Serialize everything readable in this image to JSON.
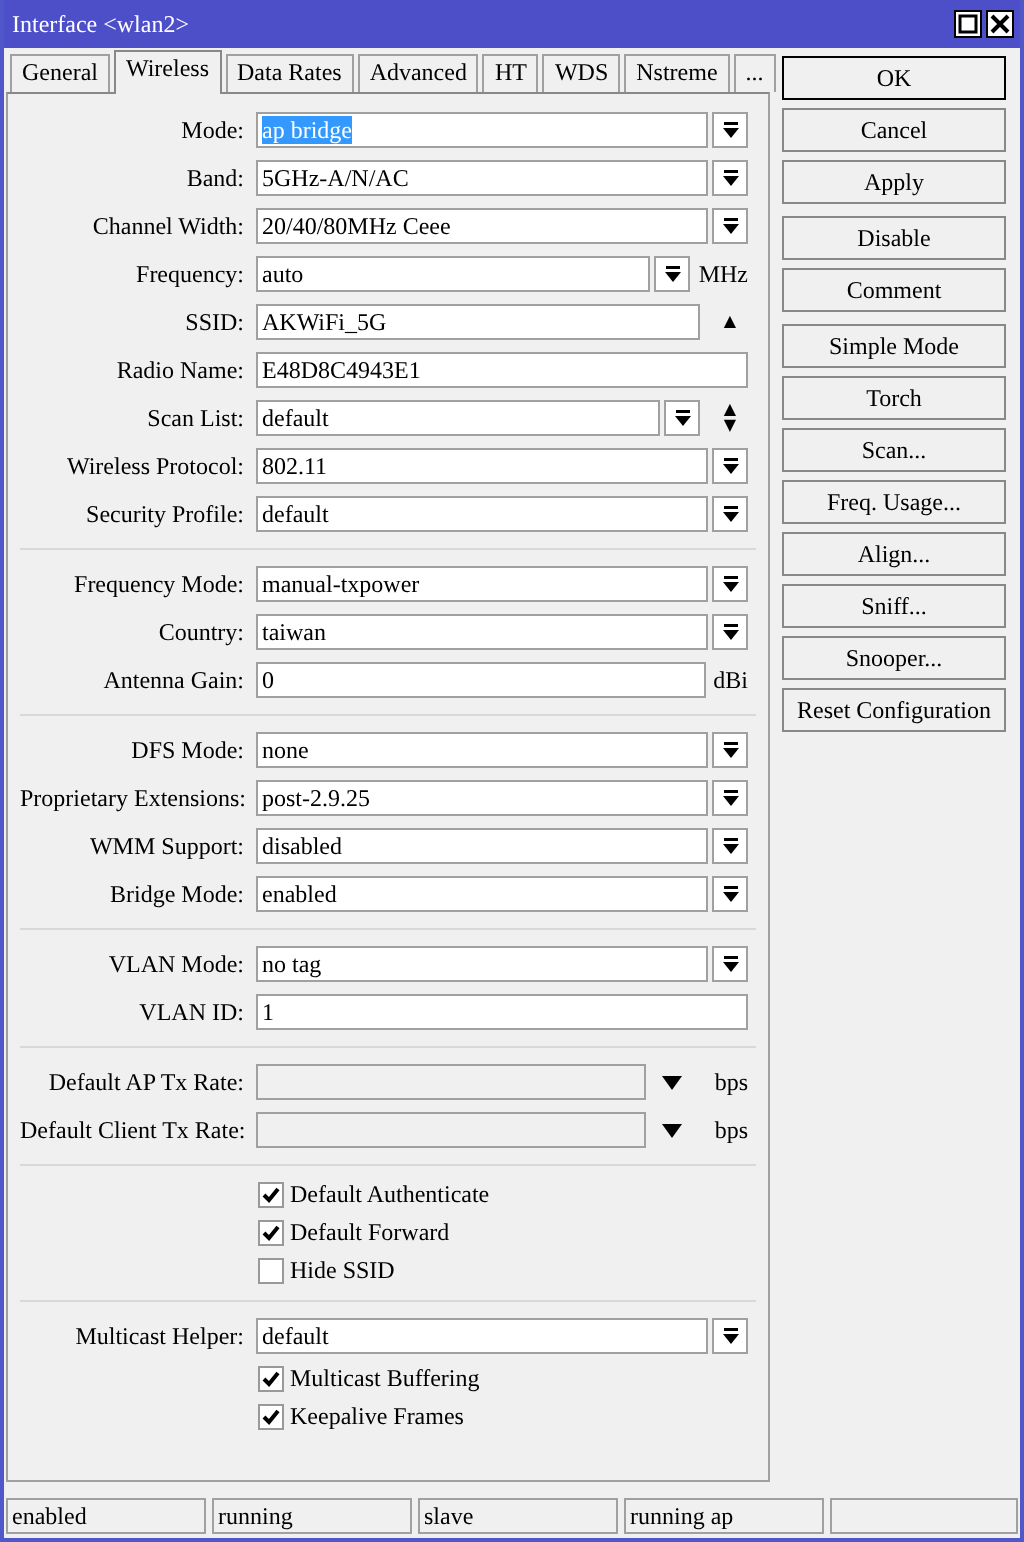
{
  "window": {
    "title": "Interface <wlan2>"
  },
  "tabs": [
    {
      "label": "General",
      "selected": false
    },
    {
      "label": "Wireless",
      "selected": true
    },
    {
      "label": "Data Rates",
      "selected": false
    },
    {
      "label": "Advanced",
      "selected": false
    },
    {
      "label": "HT",
      "selected": false
    },
    {
      "label": "WDS",
      "selected": false
    },
    {
      "label": "Nstreme",
      "selected": false
    },
    {
      "label": "...",
      "selected": false
    }
  ],
  "sections": [
    {
      "rows": [
        {
          "kind": "select",
          "label": "Mode:",
          "value": "ap bridge",
          "highlighted": true
        },
        {
          "kind": "select",
          "label": "Band:",
          "value": "5GHz-A/N/AC",
          "highlighted": false
        },
        {
          "kind": "select",
          "label": "Channel Width:",
          "value": "20/40/80MHz Ceee",
          "highlighted": false
        },
        {
          "kind": "select",
          "label": "Frequency:",
          "value": "auto",
          "unit": "MHz",
          "highlighted": false
        },
        {
          "kind": "input",
          "label": "SSID:",
          "value": "AKWiFi_5G",
          "spin": [
            "▲"
          ],
          "highlighted": false
        },
        {
          "kind": "input",
          "label": "Radio Name:",
          "value": "E48D8C4943E1",
          "highlighted": false
        },
        {
          "kind": "select",
          "label": "Scan List:",
          "value": "default",
          "spin": [
            "▲",
            "▼"
          ],
          "highlighted": false
        },
        {
          "kind": "select",
          "label": "Wireless Protocol:",
          "value": "802.11",
          "highlighted": false
        },
        {
          "kind": "select",
          "label": "Security Profile:",
          "value": "default",
          "highlighted": false
        }
      ]
    },
    {
      "rows": [
        {
          "kind": "select",
          "label": "Frequency Mode:",
          "value": "manual-txpower",
          "highlighted": false
        },
        {
          "kind": "select",
          "label": "Country:",
          "value": "taiwan",
          "highlighted": false
        },
        {
          "kind": "input",
          "label": "Antenna Gain:",
          "value": "0",
          "unit": "dBi",
          "highlighted": false
        }
      ]
    },
    {
      "rows": [
        {
          "kind": "select",
          "label": "DFS Mode:",
          "value": "none",
          "highlighted": false
        },
        {
          "kind": "select",
          "label": "Proprietary Extensions:",
          "value": "post-2.9.25",
          "highlighted": false
        },
        {
          "kind": "select",
          "label": "WMM Support:",
          "value": "disabled",
          "highlighted": false
        },
        {
          "kind": "select",
          "label": "Bridge Mode:",
          "value": "enabled",
          "highlighted": false
        }
      ]
    },
    {
      "rows": [
        {
          "kind": "select",
          "label": "VLAN Mode:",
          "value": "no tag",
          "highlighted": false
        },
        {
          "kind": "input",
          "label": "VLAN ID:",
          "value": "1",
          "highlighted": false
        }
      ]
    },
    {
      "rows": [
        {
          "kind": "combo",
          "label": "Default AP Tx Rate:",
          "unit": "bps",
          "disabled": true
        },
        {
          "kind": "combo",
          "label": "Default Client Tx Rate:",
          "unit": "bps",
          "disabled": true
        }
      ]
    },
    {
      "rows": [
        {
          "kind": "check",
          "label": "Default Authenticate",
          "checked": true
        },
        {
          "kind": "check",
          "label": "Default Forward",
          "checked": true
        },
        {
          "kind": "check",
          "label": "Hide SSID",
          "checked": false
        }
      ]
    },
    {
      "rows": [
        {
          "kind": "select",
          "label": "Multicast Helper:",
          "value": "default",
          "highlighted": false
        },
        {
          "kind": "check",
          "label": "Multicast Buffering",
          "checked": true
        },
        {
          "kind": "check",
          "label": "Keepalive Frames",
          "checked": true
        }
      ]
    }
  ],
  "button_groups": [
    [
      {
        "label": "OK",
        "default": true
      },
      {
        "label": "Cancel",
        "default": false
      },
      {
        "label": "Apply",
        "default": false
      }
    ],
    [
      {
        "label": "Disable",
        "default": false
      },
      {
        "label": "Comment",
        "default": false
      }
    ],
    [
      {
        "label": "Simple Mode",
        "default": false
      },
      {
        "label": "Torch",
        "default": false
      },
      {
        "label": "Scan...",
        "default": false
      },
      {
        "label": "Freq. Usage...",
        "default": false
      },
      {
        "label": "Align...",
        "default": false
      },
      {
        "label": "Sniff...",
        "default": false
      },
      {
        "label": "Snooper...",
        "default": false
      },
      {
        "label": "Reset Configuration",
        "default": false
      }
    ]
  ],
  "status_bar": [
    "enabled",
    "running",
    "slave",
    "running ap"
  ]
}
